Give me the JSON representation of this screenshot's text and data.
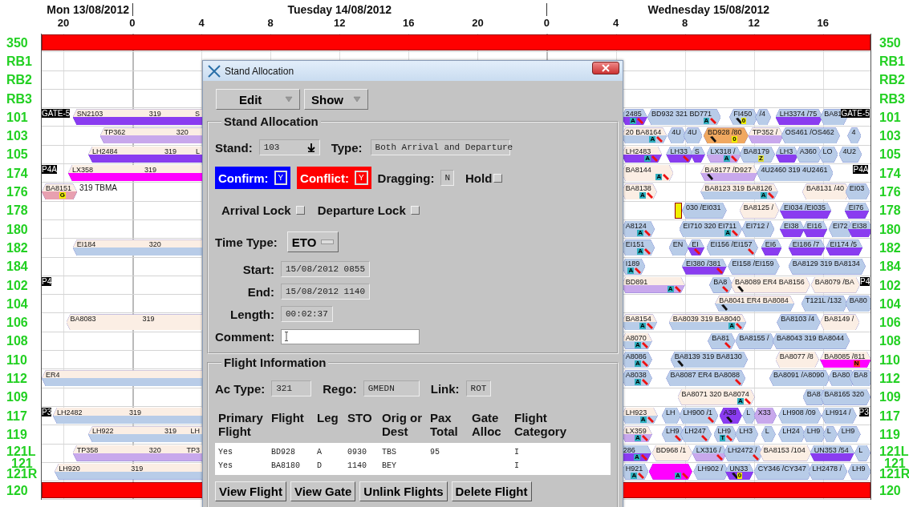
{
  "timeline": {
    "days": [
      {
        "label": "Mon 13/08/2012"
      },
      {
        "label": "Tuesday 14/08/2012"
      },
      {
        "label": "Wednesday 15/08/2012"
      }
    ],
    "ticks": [
      {
        "label": "20"
      },
      {
        "label": "0"
      },
      {
        "label": "4"
      },
      {
        "label": "8"
      },
      {
        "label": "12"
      },
      {
        "label": "16"
      },
      {
        "label": "20"
      },
      {
        "label": "0"
      },
      {
        "label": "4"
      },
      {
        "label": "8"
      },
      {
        "label": "12"
      },
      {
        "label": "16"
      }
    ]
  },
  "rows": [
    {
      "label": "350",
      "right_label": "350",
      "items": [
        {
          "kind": "block",
          "color": "#ff0000"
        }
      ]
    },
    {
      "label": "RB1",
      "right_label": "RB1"
    },
    {
      "label": "RB2",
      "right_label": "RB2"
    },
    {
      "label": "RB3",
      "right_label": "RB3"
    },
    {
      "label": "101",
      "right_label": "101",
      "items": [
        {
          "kind": "tag",
          "text": "GATE-5"
        },
        {
          "kind": "paired",
          "color": "#8a3cf0",
          "texts": [
            "SN2103",
            "319",
            "S"
          ]
        },
        {
          "kind": "banded",
          "color": "#8a3cf0",
          "texts": [
            "2485"
          ],
          "tag": {
            "text": "A",
            "color": "#30b0c0"
          },
          "alert": true
        },
        {
          "kind": "flight",
          "color": "#b8cce8",
          "texts": [
            "BD932 321 BD771"
          ],
          "tag": {
            "text": "A",
            "color": "#30b0c0"
          },
          "alert": true
        },
        {
          "kind": "flight",
          "color": "#b8cce8",
          "texts": [
            "FI450"
          ],
          "note": true,
          "tag": {
            "text": "0",
            "color": "#f0f000"
          }
        },
        {
          "kind": "flight",
          "color": "#b8cce8",
          "texts": [
            "/4"
          ]
        },
        {
          "kind": "banded",
          "color": "#8a3cf0",
          "texts": [
            "LH3374 /75"
          ]
        },
        {
          "kind": "flight",
          "color": "#b8cce8",
          "texts": [
            "BA81"
          ]
        },
        {
          "kind": "tag",
          "text": "GATE-5"
        }
      ]
    },
    {
      "label": "103",
      "right_label": "103",
      "items": [
        {
          "kind": "paired",
          "color": "#c8a8ec",
          "texts": [
            "TP362",
            "320"
          ]
        },
        {
          "kind": "paired",
          "color": "#b8cce8",
          "texts": [
            "20 BA8164"
          ],
          "tag": {
            "text": "A",
            "color": "#30b0c0"
          },
          "alert": true
        },
        {
          "kind": "flight",
          "color": "#b8cce8",
          "texts": [
            "4U"
          ]
        },
        {
          "kind": "flight",
          "color": "#b8cce8",
          "texts": [
            "4U"
          ]
        },
        {
          "kind": "flight",
          "color": "#f0a860",
          "texts": [
            "BD928 /80"
          ],
          "note": true,
          "tag": {
            "text": "0",
            "color": "#f0f000"
          }
        },
        {
          "kind": "paired",
          "color": "#c8a8ec",
          "texts": [
            "TP352 /"
          ]
        },
        {
          "kind": "flight",
          "color": "#b8cce8",
          "texts": [
            "OS461 /OS462"
          ]
        },
        {
          "kind": "flight",
          "color": "#b8cce8",
          "texts": [
            "4"
          ]
        }
      ]
    },
    {
      "label": "105",
      "right_label": "105",
      "items": [
        {
          "kind": "paired",
          "color": "#8a3cf0",
          "texts": [
            "LH2484",
            "319",
            "L"
          ]
        },
        {
          "kind": "paired",
          "color": "#8a3cf0",
          "texts": [
            "LH2483"
          ],
          "tag": {
            "text": "A",
            "color": "#30b0c0"
          },
          "alert": true
        },
        {
          "kind": "banded",
          "color": "#8a3cf0",
          "texts": [
            "LH33"
          ],
          "alert": true
        },
        {
          "kind": "banded",
          "color": "#8a3cf0",
          "texts": [
            "S"
          ]
        },
        {
          "kind": "banded",
          "color": "#c8a8ec",
          "texts": [
            "LX318 /"
          ],
          "tag": {
            "text": "A",
            "color": "#30b0c0"
          },
          "alert": true
        },
        {
          "kind": "flight",
          "color": "#b8cce8",
          "texts": [
            "BA8179"
          ],
          "tag": {
            "text": "Z",
            "color": "#e0e040"
          }
        },
        {
          "kind": "banded",
          "color": "#8a3cf0",
          "texts": [
            "LH3"
          ]
        },
        {
          "kind": "flight",
          "color": "#b8cce8",
          "texts": [
            "A360"
          ]
        },
        {
          "kind": "flight",
          "color": "#b8cce8",
          "texts": [
            "LO"
          ]
        },
        {
          "kind": "flight",
          "color": "#b8cce8",
          "texts": [
            "4U2"
          ]
        }
      ]
    },
    {
      "label": "174",
      "right_label": "174",
      "items": [
        {
          "kind": "tag",
          "text": "P4A"
        },
        {
          "kind": "paired",
          "color": "#ff00ff",
          "texts": [
            "LX358",
            "319"
          ]
        },
        {
          "kind": "flight",
          "color": "#fbeee4",
          "texts": [
            "BA8144"
          ],
          "tag": {
            "text": "A",
            "color": "#30b0c0"
          },
          "alert": true
        },
        {
          "kind": "paired",
          "color": "#c8a8ec",
          "texts": [
            "BA8177 /D927"
          ],
          "note": true
        },
        {
          "kind": "flight",
          "color": "#b8cce8",
          "texts": [
            "4U2460 319 4U2461"
          ]
        },
        {
          "kind": "tag",
          "text": "P4A"
        }
      ]
    },
    {
      "label": "176",
      "right_label": "176",
      "items": [
        {
          "kind": "paired",
          "color": "#e8a0b0",
          "texts": [
            "BA8151"
          ],
          "tag": {
            "text": "G",
            "color": "#f0f000"
          },
          "after": "319 TBMA"
        },
        {
          "kind": "flight",
          "color": "#fbeee4",
          "texts": [
            "BA8138"
          ],
          "tag": {
            "text": "A",
            "color": "#30b0c0"
          },
          "alert": true
        },
        {
          "kind": "paired",
          "color": "#b8cce8",
          "texts": [
            "BA8123 319 BA8126"
          ],
          "tag": {
            "text": "A",
            "color": "#30b0c0"
          },
          "alert": true
        },
        {
          "kind": "flight",
          "color": "#fbeee4",
          "texts": [
            "BA8131 /40"
          ]
        },
        {
          "kind": "flight",
          "color": "#b8cce8",
          "texts": [
            "EI03"
          ]
        }
      ]
    },
    {
      "label": "178",
      "right_label": "178",
      "items": [
        {
          "kind": "block",
          "color": "#f0f000"
        },
        {
          "kind": "flight",
          "color": "#b8cce8",
          "texts": [
            "030 /EI031"
          ]
        },
        {
          "kind": "flight",
          "color": "#fbeee4",
          "texts": [
            "BA8125 /"
          ]
        },
        {
          "kind": "banded",
          "color": "#8a3cf0",
          "texts": [
            "EI034 /EI035"
          ]
        },
        {
          "kind": "banded",
          "color": "#8a3cf0",
          "texts": [
            "EI76"
          ]
        }
      ]
    },
    {
      "label": "180",
      "right_label": "180",
      "items": [
        {
          "kind": "flight",
          "color": "#b8cce8",
          "texts": [
            "A8124"
          ],
          "tag": {
            "text": "A",
            "color": "#30b0c0"
          },
          "alert": true
        },
        {
          "kind": "flight",
          "color": "#b8cce8",
          "texts": [
            "EI710 320 EI711"
          ],
          "tag": {
            "text": "A",
            "color": "#30b0c0"
          },
          "alert": true
        },
        {
          "kind": "flight",
          "color": "#b8cce8",
          "texts": [
            "EI712 /"
          ]
        },
        {
          "kind": "banded",
          "color": "#8a3cf0",
          "texts": [
            "EI38"
          ]
        },
        {
          "kind": "banded",
          "color": "#8a3cf0",
          "texts": [
            "EI16"
          ]
        },
        {
          "kind": "flight",
          "color": "#b8cce8",
          "texts": [
            "EI72"
          ]
        },
        {
          "kind": "banded",
          "color": "#8a3cf0",
          "texts": [
            "EI38"
          ]
        }
      ]
    },
    {
      "label": "182",
      "right_label": "182",
      "items": [
        {
          "kind": "paired",
          "color": "#b8cce8",
          "texts": [
            "EI184",
            "320"
          ]
        },
        {
          "kind": "flight",
          "color": "#b8cce8",
          "texts": [
            "EI151"
          ],
          "tag": {
            "text": "A",
            "color": "#30b0c0"
          },
          "alert": true
        },
        {
          "kind": "flight",
          "color": "#b8cce8",
          "texts": [
            "EN"
          ]
        },
        {
          "kind": "banded",
          "color": "#8a3cf0",
          "texts": [
            "EI"
          ],
          "alert": true
        },
        {
          "kind": "flight",
          "color": "#b8cce8",
          "texts": [
            "EI156 /EI157"
          ],
          "alert": true
        },
        {
          "kind": "banded",
          "color": "#8a3cf0",
          "texts": [
            "EI6"
          ]
        },
        {
          "kind": "banded",
          "color": "#8a3cf0",
          "texts": [
            "EI186 /7"
          ]
        },
        {
          "kind": "banded",
          "color": "#8a3cf0",
          "texts": [
            "EI174 /5"
          ]
        }
      ]
    },
    {
      "label": "184",
      "right_label": "184",
      "items": [
        {
          "kind": "flight",
          "color": "#b8cce8",
          "texts": [
            "I189"
          ],
          "tag": {
            "text": "A",
            "color": "#30b0c0"
          },
          "alert": true
        },
        {
          "kind": "banded",
          "color": "#8a3cf0",
          "texts": [
            "EI380 /381"
          ],
          "alert": true
        },
        {
          "kind": "flight",
          "color": "#b8cce8",
          "texts": [
            "EI158 /EI159"
          ]
        },
        {
          "kind": "flight",
          "color": "#b8cce8",
          "texts": [
            "BA8129 319 BA8134"
          ]
        }
      ]
    },
    {
      "label": "102",
      "right_label": "102",
      "items": [
        {
          "kind": "tag",
          "text": "P4"
        },
        {
          "kind": "paired",
          "color": "#c8a8ec",
          "texts": [
            "BD891"
          ],
          "tag": {
            "text": "A",
            "color": "#30b0c0"
          },
          "alert": true
        },
        {
          "kind": "flight",
          "color": "#b8cce8",
          "texts": [
            "BA8"
          ],
          "alert": true
        },
        {
          "kind": "flight",
          "color": "#fbeee4",
          "texts": [
            "BA8089 ER4 BA8156"
          ],
          "note": true
        },
        {
          "kind": "flight",
          "color": "#fbeee4",
          "texts": [
            "BA8079 /BA"
          ]
        },
        {
          "kind": "tag",
          "text": "P4"
        }
      ]
    },
    {
      "label": "104",
      "right_label": "104",
      "items": [
        {
          "kind": "paired",
          "color": "#b8cce8",
          "texts": [
            "BA8041 ER4 BA8084"
          ],
          "note": true
        },
        {
          "kind": "flight",
          "color": "#b8cce8",
          "texts": [
            "T121L /132"
          ]
        },
        {
          "kind": "flight",
          "color": "#b8cce8",
          "texts": [
            "BA80"
          ]
        }
      ]
    },
    {
      "label": "106",
      "right_label": "106",
      "items": [
        {
          "kind": "flight",
          "color": "#fbeee4",
          "texts": [
            "BA8083",
            "319"
          ]
        },
        {
          "kind": "paired",
          "color": "#b8cce8",
          "texts": [
            "BA8154"
          ],
          "tag": {
            "text": "A",
            "color": "#30b0c0"
          },
          "alert": true
        },
        {
          "kind": "paired",
          "color": "#b8cce8",
          "texts": [
            "BA8039 319 BA8040"
          ],
          "tag": {
            "text": "A",
            "color": "#30b0c0"
          },
          "alert": true
        },
        {
          "kind": "flight",
          "color": "#b8cce8",
          "texts": [
            "BA8103 /4"
          ]
        },
        {
          "kind": "flight",
          "color": "#fbeee4",
          "texts": [
            "BA8149 /"
          ]
        }
      ]
    },
    {
      "label": "108",
      "right_label": "108",
      "items": [
        {
          "kind": "paired",
          "color": "#b8cce8",
          "texts": [
            "A8070"
          ],
          "tag": {
            "text": "A",
            "color": "#30b0c0"
          },
          "alert": true
        },
        {
          "kind": "flight",
          "color": "#b8cce8",
          "texts": [
            "BA81"
          ],
          "alert": true
        },
        {
          "kind": "flight",
          "color": "#b8cce8",
          "texts": [
            "BA8155 /"
          ]
        },
        {
          "kind": "flight",
          "color": "#b8cce8",
          "texts": [
            "BA8043 319 BA8044"
          ]
        }
      ]
    },
    {
      "label": "110",
      "right_label": "110",
      "items": [
        {
          "kind": "flight",
          "color": "#b8cce8",
          "texts": [
            "A8086"
          ],
          "tag": {
            "text": "A",
            "color": "#30b0c0"
          },
          "alert": true
        },
        {
          "kind": "flight",
          "color": "#b8cce8",
          "texts": [
            "BA8139 319 BA8130"
          ],
          "note": true
        },
        {
          "kind": "flight",
          "color": "#fbeee4",
          "texts": [
            "BA8077 /8"
          ]
        },
        {
          "kind": "paired",
          "color": "#ff00ff",
          "texts": [
            "BA8085 /811"
          ],
          "tag": {
            "text": "N",
            "color": "#ff3030"
          }
        }
      ]
    },
    {
      "label": "112",
      "right_label": "112",
      "items": [
        {
          "kind": "paired",
          "color": "#b8cce8",
          "texts": [
            "ER4"
          ]
        },
        {
          "kind": "flight",
          "color": "#b8cce8",
          "texts": [
            "A8038"
          ],
          "tag": {
            "text": "A",
            "color": "#30b0c0"
          },
          "alert": true
        },
        {
          "kind": "flight",
          "color": "#b8cce8",
          "texts": [
            "BA8087 ER4 BA8088"
          ],
          "alert": true
        },
        {
          "kind": "flight",
          "color": "#b8cce8",
          "texts": [
            "BA8091 /A8090"
          ]
        },
        {
          "kind": "flight",
          "color": "#b8cce8",
          "texts": [
            "BA80"
          ]
        },
        {
          "kind": "flight",
          "color": "#b8cce8",
          "texts": [
            "BA8"
          ]
        }
      ]
    },
    {
      "label": "109",
      "right_label": "109",
      "items": [
        {
          "kind": "flight",
          "color": "#fbeee4",
          "texts": [
            "BA8071 320 BA8074"
          ],
          "tag": {
            "text": "A",
            "color": "#30b0c0"
          },
          "alert": true
        },
        {
          "kind": "flight",
          "color": "#b8cce8",
          "texts": [
            "BA8"
          ]
        },
        {
          "kind": "flight",
          "color": "#b8cce8",
          "texts": [
            "BA8165 320"
          ]
        }
      ]
    },
    {
      "label": "117",
      "right_label": "117",
      "items": [
        {
          "kind": "tag",
          "text": "P3"
        },
        {
          "kind": "paired",
          "color": "#b8cce8",
          "texts": [
            "LH2482",
            "319"
          ]
        },
        {
          "kind": "paired",
          "color": "#b8cce8",
          "texts": [
            "LH923"
          ],
          "tag": {
            "text": "A",
            "color": "#30b0c0"
          },
          "alert": true
        },
        {
          "kind": "flight",
          "color": "#b8cce8",
          "texts": [
            "LH"
          ]
        },
        {
          "kind": "flight",
          "color": "#b8cce8",
          "texts": [
            "LH900 /1"
          ],
          "alert": true
        },
        {
          "kind": "flight",
          "color": "#8a3cf0",
          "texts": [
            "A38"
          ],
          "note": true
        },
        {
          "kind": "flight",
          "color": "#b8cce8",
          "texts": [
            "L"
          ]
        },
        {
          "kind": "flight",
          "color": "#c8a8ec",
          "texts": [
            "X33"
          ]
        },
        {
          "kind": "flight",
          "color": "#b8cce8",
          "texts": [
            "LH908 /09"
          ]
        },
        {
          "kind": "flight",
          "color": "#b8cce8",
          "texts": [
            "LH914 /"
          ]
        },
        {
          "kind": "tag",
          "text": "P3"
        }
      ]
    },
    {
      "label": "119",
      "right_label": "119",
      "items": [
        {
          "kind": "paired",
          "color": "#b8cce8",
          "texts": [
            "LH922",
            "319",
            "LH"
          ]
        },
        {
          "kind": "paired",
          "color": "#c8a8ec",
          "texts": [
            "LX359"
          ],
          "tag": {
            "text": "A",
            "color": "#30b0c0"
          },
          "alert": true
        },
        {
          "kind": "flight",
          "color": "#b8cce8",
          "texts": [
            "LH9"
          ],
          "alert": true
        },
        {
          "kind": "flight",
          "color": "#b8cce8",
          "texts": [
            "LH247"
          ],
          "alert": true
        },
        {
          "kind": "flight",
          "color": "#b8cce8",
          "texts": [
            "LH9"
          ],
          "tag": {
            "text": "T",
            "color": "#30b0c0"
          },
          "alert": true
        },
        {
          "kind": "flight",
          "color": "#b8cce8",
          "texts": [
            "LH3"
          ]
        },
        {
          "kind": "flight",
          "color": "#b8cce8",
          "texts": [
            "L"
          ]
        },
        {
          "kind": "flight",
          "color": "#b8cce8",
          "texts": [
            "LH24"
          ]
        },
        {
          "kind": "flight",
          "color": "#b8cce8",
          "texts": [
            "LH9"
          ]
        },
        {
          "kind": "flight",
          "color": "#b8cce8",
          "texts": [
            "L"
          ]
        },
        {
          "kind": "flight",
          "color": "#b8cce8",
          "texts": [
            "LH9"
          ]
        }
      ]
    },
    {
      "label": "121L",
      "right_label": "121L",
      "items": [
        {
          "kind": "paired",
          "color": "#c8a8ec",
          "texts": [
            "TP358",
            "320",
            "TP3"
          ]
        },
        {
          "kind": "banded",
          "color": "#8a3cf0",
          "texts": [
            "286"
          ],
          "tag": {
            "text": "A",
            "color": "#30b0c0"
          },
          "alert": true
        },
        {
          "kind": "flight",
          "color": "#fbeee4",
          "texts": [
            "BD968 /1"
          ]
        },
        {
          "kind": "banded",
          "color": "#c8a8ec",
          "texts": [
            "LX316 /"
          ],
          "alert": true
        },
        {
          "kind": "flight",
          "color": "#b8cce8",
          "texts": [
            "LH2472 /"
          ],
          "alert": true
        },
        {
          "kind": "flight",
          "color": "#fbeee4",
          "texts": [
            "BA8153 /104"
          ]
        },
        {
          "kind": "banded",
          "color": "#8a3cf0",
          "texts": [
            "UN353 /54"
          ]
        },
        {
          "kind": "flight",
          "color": "#b8cce8",
          "texts": [
            "L"
          ]
        }
      ]
    },
    {
      "label": "121R",
      "right_label": "121R",
      "between_label": "121",
      "right_between_label": "121",
      "items": [
        {
          "kind": "paired",
          "color": "#b8cce8",
          "texts": [
            "LH920",
            "319"
          ]
        },
        {
          "kind": "flight",
          "color": "#b8cce8",
          "texts": [
            "H921"
          ],
          "tag": {
            "text": "A",
            "color": "#30b0c0"
          },
          "alert": true
        },
        {
          "kind": "flight",
          "color": "#ff00ff",
          "tag": {
            "text": "A",
            "color": "#30b0c0"
          },
          "alert": true
        },
        {
          "kind": "flight",
          "color": "#b8cce8",
          "texts": [
            "LH902 /"
          ]
        },
        {
          "kind": "banded",
          "color": "#8a3cf0",
          "texts": [
            "UN33"
          ],
          "note": true,
          "tag": {
            "text": "0",
            "color": "#f0f000"
          }
        },
        {
          "kind": "flight",
          "color": "#b8cce8",
          "texts": [
            "CY346 /CY347"
          ]
        },
        {
          "kind": "flight",
          "color": "#b8cce8",
          "texts": [
            "LH2478 /"
          ]
        },
        {
          "kind": "flight",
          "color": "#b8cce8",
          "texts": [
            "LH9"
          ]
        }
      ]
    },
    {
      "label": "120",
      "right_label": "120",
      "items": [
        {
          "kind": "block",
          "color": "#ff0000"
        }
      ]
    }
  ],
  "dialog": {
    "title": "Stand Allocation",
    "menus": [
      {
        "label": "Edit"
      },
      {
        "label": "Show"
      }
    ],
    "allocation": {
      "title": "Stand Allocation",
      "stand_label": "Stand:",
      "stand": "103",
      "type_label": "Type:",
      "type": "Both Arrival and Departure",
      "confirm_label": "Confirm:",
      "confirm": "Y",
      "conflict_label": "Conflict:",
      "conflict": "Y",
      "dragging_label": "Dragging:",
      "dragging": "N",
      "hold": {
        "label": "Hold",
        "checked": false
      },
      "locks": [
        {
          "label": "Arrival Lock",
          "checked": false
        },
        {
          "label": "Departure Lock",
          "checked": false
        }
      ],
      "time_type_label": "Time Type:",
      "time_type": "ETO",
      "times": [
        {
          "label": "Start:",
          "value": "15/08/2012 0855"
        },
        {
          "label": "End:",
          "value": "15/08/2012 1140"
        },
        {
          "label": "Length:",
          "value": "00:02:37"
        }
      ],
      "comment_label": "Comment:"
    },
    "flight_info": {
      "title": "Flight Information",
      "ac_type_label": "Ac Type:",
      "ac_type": "321",
      "rego_label": "Rego:",
      "rego": "GMEDN",
      "link_label": "Link:",
      "link": "ROT",
      "columns": [
        "Primary Flight",
        "Flight",
        "Leg",
        "STO",
        "Orig or Dest",
        "Pax Total",
        "Gate Alloc",
        "Flight Category"
      ],
      "rows": [
        [
          "Yes",
          "BD928",
          "A",
          "0930",
          "TBS",
          "95",
          null,
          "I"
        ],
        [
          "Yes",
          "BA8180",
          "D",
          "1140",
          "BEY",
          null,
          null,
          "I"
        ]
      ],
      "buttons": [
        "View Flight",
        "View Gate",
        "Unlink Flights",
        "Delete Flight"
      ]
    }
  }
}
